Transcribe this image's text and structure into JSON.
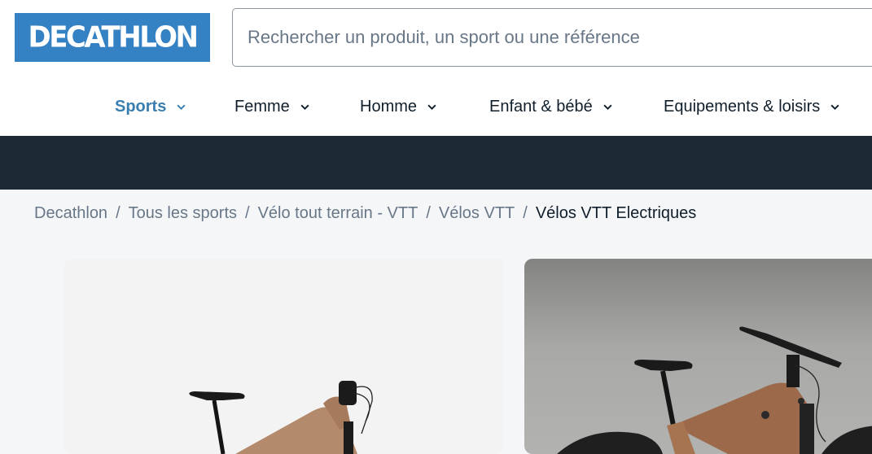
{
  "header": {
    "logo_text": "DECATHLON",
    "brand_color": "#3481c3",
    "search": {
      "placeholder": "Rechercher un produit, un sport ou une référence",
      "value": ""
    }
  },
  "nav": {
    "items": [
      {
        "label": "Sports",
        "active": true,
        "icon": "chevron-down-icon"
      },
      {
        "label": "Femme",
        "active": false,
        "icon": "chevron-down-icon"
      },
      {
        "label": "Homme",
        "active": false,
        "icon": "chevron-down-icon"
      },
      {
        "label": "Enfant & bébé",
        "active": false,
        "icon": "chevron-down-icon"
      },
      {
        "label": "Equipements & loisirs",
        "active": false,
        "icon": "chevron-down-icon"
      }
    ],
    "active_color": "#3a7eb0"
  },
  "banner": {
    "color": "#1b2a35"
  },
  "breadcrumb": {
    "items": [
      {
        "label": "Decathlon"
      },
      {
        "label": "Tous les sports"
      },
      {
        "label": "Vélo tout terrain - VTT"
      },
      {
        "label": "Vélos VTT"
      },
      {
        "label": "Vélos VTT Electriques",
        "current": true
      }
    ],
    "separator": "/"
  },
  "products": [
    {
      "image": "electric-mountain-bike-side-view",
      "alt": "Vélo VTT électrique cuivre sur fond clair"
    },
    {
      "image": "electric-mountain-bike-studio",
      "alt": "Vélo VTT électrique cuivre sur fond gris"
    }
  ]
}
